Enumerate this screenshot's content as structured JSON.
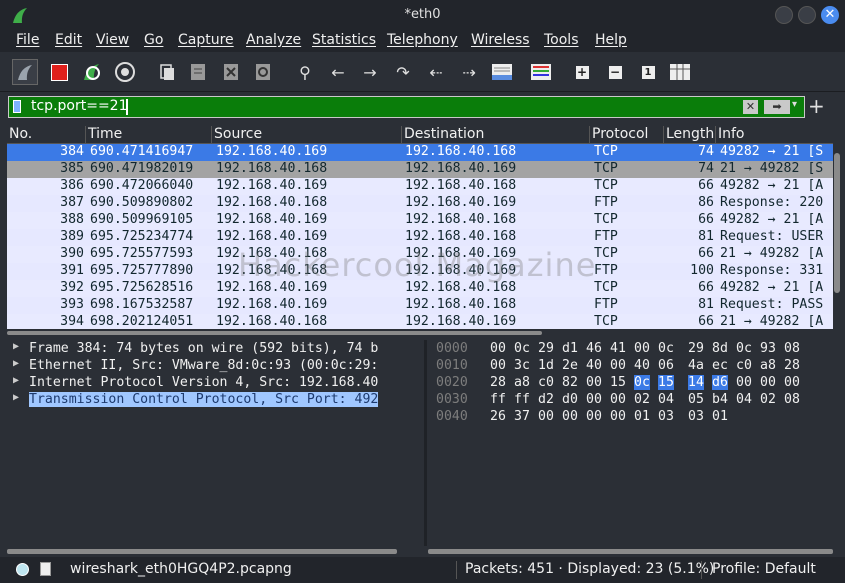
{
  "window": {
    "title": "*eth0"
  },
  "menu": [
    "File",
    "Edit",
    "View",
    "Go",
    "Capture",
    "Analyze",
    "Statistics",
    "Telephony",
    "Wireless",
    "Tools",
    "Help"
  ],
  "filter": {
    "value": "tcp.port==21"
  },
  "columns": [
    "No.",
    "Time",
    "Source",
    "Destination",
    "Protocol",
    "Length",
    "Info"
  ],
  "packets": [
    {
      "no": "384",
      "time": "690.471416947",
      "src": "192.168.40.169",
      "dst": "192.168.40.168",
      "proto": "TCP",
      "len": "74",
      "info": "49282 → 21 [S"
    },
    {
      "no": "385",
      "time": "690.471982019",
      "src": "192.168.40.168",
      "dst": "192.168.40.169",
      "proto": "TCP",
      "len": "74",
      "info": "21 → 49282 [S"
    },
    {
      "no": "386",
      "time": "690.472066040",
      "src": "192.168.40.169",
      "dst": "192.168.40.168",
      "proto": "TCP",
      "len": "66",
      "info": "49282 → 21 [A"
    },
    {
      "no": "387",
      "time": "690.509890802",
      "src": "192.168.40.168",
      "dst": "192.168.40.169",
      "proto": "FTP",
      "len": "86",
      "info": "Response: 220"
    },
    {
      "no": "388",
      "time": "690.509969105",
      "src": "192.168.40.169",
      "dst": "192.168.40.168",
      "proto": "TCP",
      "len": "66",
      "info": "49282 → 21 [A"
    },
    {
      "no": "389",
      "time": "695.725234774",
      "src": "192.168.40.169",
      "dst": "192.168.40.168",
      "proto": "FTP",
      "len": "81",
      "info": "Request: USER"
    },
    {
      "no": "390",
      "time": "695.725577593",
      "src": "192.168.40.168",
      "dst": "192.168.40.169",
      "proto": "TCP",
      "len": "66",
      "info": "21 → 49282 [A"
    },
    {
      "no": "391",
      "time": "695.725777890",
      "src": "192.168.40.168",
      "dst": "192.168.40.169",
      "proto": "FTP",
      "len": "100",
      "info": "Response: 331"
    },
    {
      "no": "392",
      "time": "695.725628516",
      "src": "192.168.40.169",
      "dst": "192.168.40.168",
      "proto": "TCP",
      "len": "66",
      "info": "49282 → 21 [A"
    },
    {
      "no": "393",
      "time": "698.167532587",
      "src": "192.168.40.169",
      "dst": "192.168.40.168",
      "proto": "FTP",
      "len": "81",
      "info": "Request: PASS"
    },
    {
      "no": "394",
      "time": "698.202124051",
      "src": "192.168.40.168",
      "dst": "192.168.40.169",
      "proto": "TCP",
      "len": "66",
      "info": "21 → 49282 [A"
    }
  ],
  "details": [
    "Frame 384: 74 bytes on wire (592 bits), 74 b",
    "Ethernet II, Src: VMware_8d:0c:93 (00:0c:29:",
    "Internet Protocol Version 4, Src: 192.168.40",
    "Transmission Control Protocol, Src Port: 492"
  ],
  "hex": [
    {
      "off": "0000",
      "bytes": [
        "00",
        "0c",
        "29",
        "d1",
        "46",
        "41",
        "00",
        "0c",
        "29",
        "8d",
        "0c",
        "93",
        "08"
      ]
    },
    {
      "off": "0010",
      "bytes": [
        "00",
        "3c",
        "1d",
        "2e",
        "40",
        "00",
        "40",
        "06",
        "4a",
        "ec",
        "c0",
        "a8",
        "28"
      ]
    },
    {
      "off": "0020",
      "bytes": [
        "28",
        "a8",
        "c0",
        "82",
        "00",
        "15",
        "0c",
        "15",
        "14",
        "d6",
        "00",
        "00",
        "00"
      ]
    },
    {
      "off": "0030",
      "bytes": [
        "ff",
        "ff",
        "d2",
        "d0",
        "00",
        "00",
        "02",
        "04",
        "05",
        "b4",
        "04",
        "02",
        "08"
      ]
    },
    {
      "off": "0040",
      "bytes": [
        "26",
        "37",
        "00",
        "00",
        "00",
        "00",
        "01",
        "03",
        "03",
        "01"
      ]
    }
  ],
  "watermark": "Hackercool Magazine",
  "status": {
    "file": "wireshark_eth0HGQ4P2.pcapng",
    "packets": "Packets: 451 · Displayed: 23 (5.1%)",
    "profile": "Profile: Default"
  }
}
